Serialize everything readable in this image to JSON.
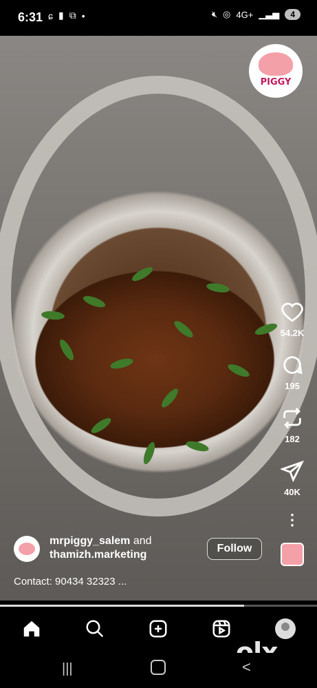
{
  "status_bar": {
    "time": "6:31",
    "network": "4G+",
    "battery": "4"
  },
  "brand_logo": {
    "text": "PIGGY"
  },
  "actions": {
    "like_count": "54.2K",
    "comment_count": "195",
    "repost_count": "182",
    "share_count": "40K"
  },
  "author": {
    "primary": "mrpiggy_salem",
    "conjunction": " and",
    "secondary": "thamizh.marketing",
    "follow_label": "Follow"
  },
  "caption": "Contact: 90434 32323 ...",
  "playback": {
    "progress": 0.77
  },
  "watermark": "olx",
  "colors": {
    "background": "#000000",
    "text": "#ffffff"
  }
}
